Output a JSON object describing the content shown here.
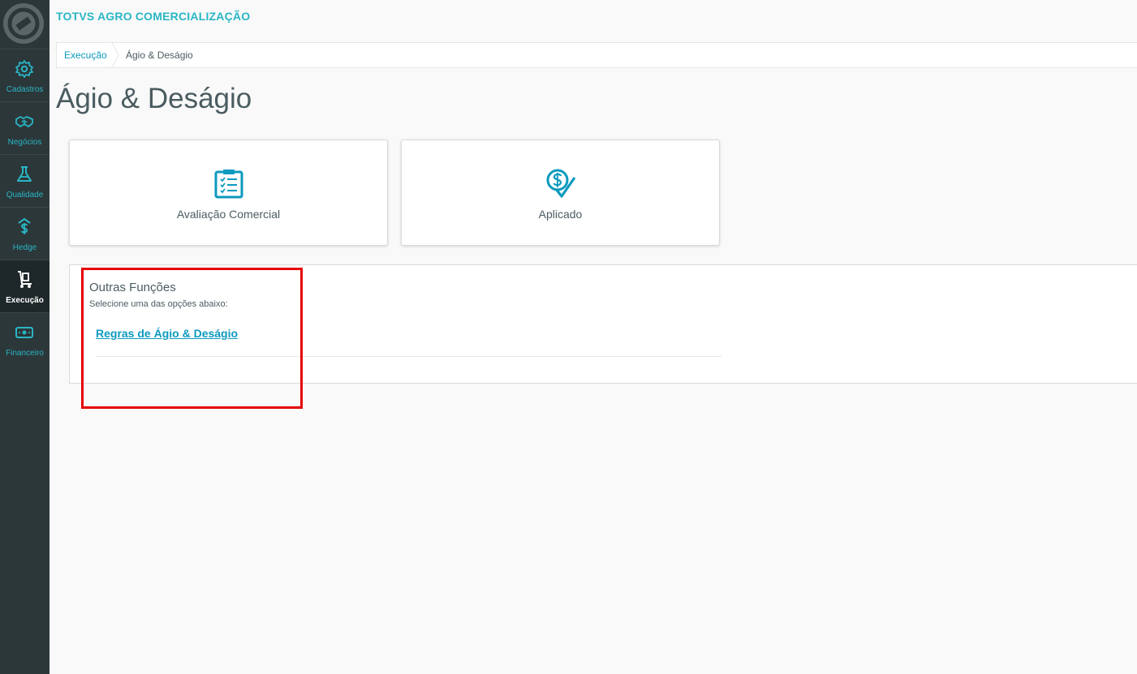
{
  "app": {
    "title": "TOTVS AGRO COMERCIALIZAÇÃO"
  },
  "sidebar": {
    "items": [
      {
        "label": "Cadastros",
        "icon": "gear-icon",
        "active": false
      },
      {
        "label": "Negócios",
        "icon": "handshake-icon",
        "active": false
      },
      {
        "label": "Qualidade",
        "icon": "flask-icon",
        "active": false
      },
      {
        "label": "Hedge",
        "icon": "dollar-arrow-icon",
        "active": false
      },
      {
        "label": "Execução",
        "icon": "hand-truck-icon",
        "active": true
      },
      {
        "label": "Financeiro",
        "icon": "money-icon",
        "active": false
      }
    ]
  },
  "breadcrumb": {
    "parent": "Execução",
    "current": "Ágio & Deságio"
  },
  "page": {
    "title": "Ágio & Deságio"
  },
  "cards": [
    {
      "label": "Avaliação Comercial",
      "icon": "clipboard-checklist-icon"
    },
    {
      "label": "Aplicado",
      "icon": "dollar-check-icon"
    }
  ],
  "outras_funcoes": {
    "title": "Outras Funções",
    "subtitle": "Selecione uma das opções abaixo:",
    "link": "Regras de Ágio & Deságio"
  },
  "colors": {
    "accent": "#29b6c5",
    "link": "#0c9abe",
    "sidebar_bg": "#2c3739",
    "highlight": "#e60000"
  }
}
